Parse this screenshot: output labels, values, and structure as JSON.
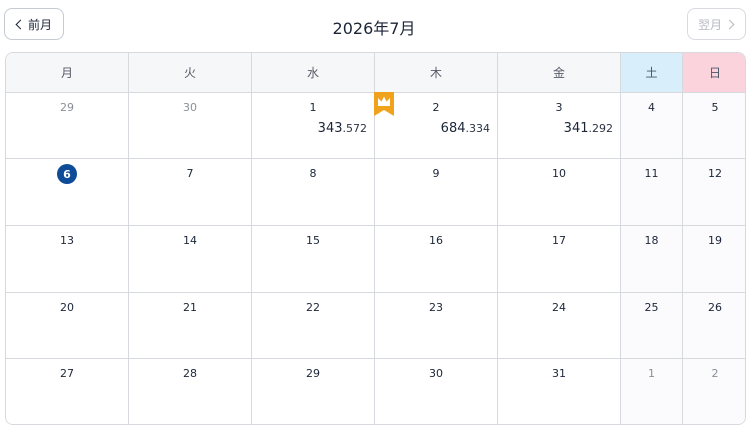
{
  "header": {
    "prev_label": "前月",
    "next_label": "翌月",
    "title": "2026年7月"
  },
  "weekdays": [
    "月",
    "火",
    "水",
    "木",
    "金",
    "土",
    "日"
  ],
  "weeks": [
    [
      {
        "day": "29",
        "muted": true
      },
      {
        "day": "30",
        "muted": true
      },
      {
        "day": "1",
        "value_int": "343",
        "value_dec": ".572"
      },
      {
        "day": "2",
        "value_int": "684",
        "value_dec": ".334",
        "crown": true
      },
      {
        "day": "3",
        "value_int": "341",
        "value_dec": ".292"
      },
      {
        "day": "4"
      },
      {
        "day": "5"
      }
    ],
    [
      {
        "day": "6",
        "today": true
      },
      {
        "day": "7"
      },
      {
        "day": "8"
      },
      {
        "day": "9"
      },
      {
        "day": "10"
      },
      {
        "day": "11"
      },
      {
        "day": "12"
      }
    ],
    [
      {
        "day": "13"
      },
      {
        "day": "14"
      },
      {
        "day": "15"
      },
      {
        "day": "16"
      },
      {
        "day": "17"
      },
      {
        "day": "18"
      },
      {
        "day": "19"
      }
    ],
    [
      {
        "day": "20"
      },
      {
        "day": "21"
      },
      {
        "day": "22"
      },
      {
        "day": "23"
      },
      {
        "day": "24"
      },
      {
        "day": "25"
      },
      {
        "day": "26"
      }
    ],
    [
      {
        "day": "27"
      },
      {
        "day": "28"
      },
      {
        "day": "29"
      },
      {
        "day": "30"
      },
      {
        "day": "31"
      },
      {
        "day": "1",
        "muted": true
      },
      {
        "day": "2",
        "muted": true
      }
    ]
  ],
  "colors": {
    "today_badge": "#0f4c97",
    "crown": "#f0a21c",
    "saturday_header": "#d8effb",
    "sunday_header": "#fbd3dc"
  },
  "icons": {
    "prev": "chevron-left-icon",
    "next": "chevron-right-icon",
    "top_day": "crown-icon"
  }
}
